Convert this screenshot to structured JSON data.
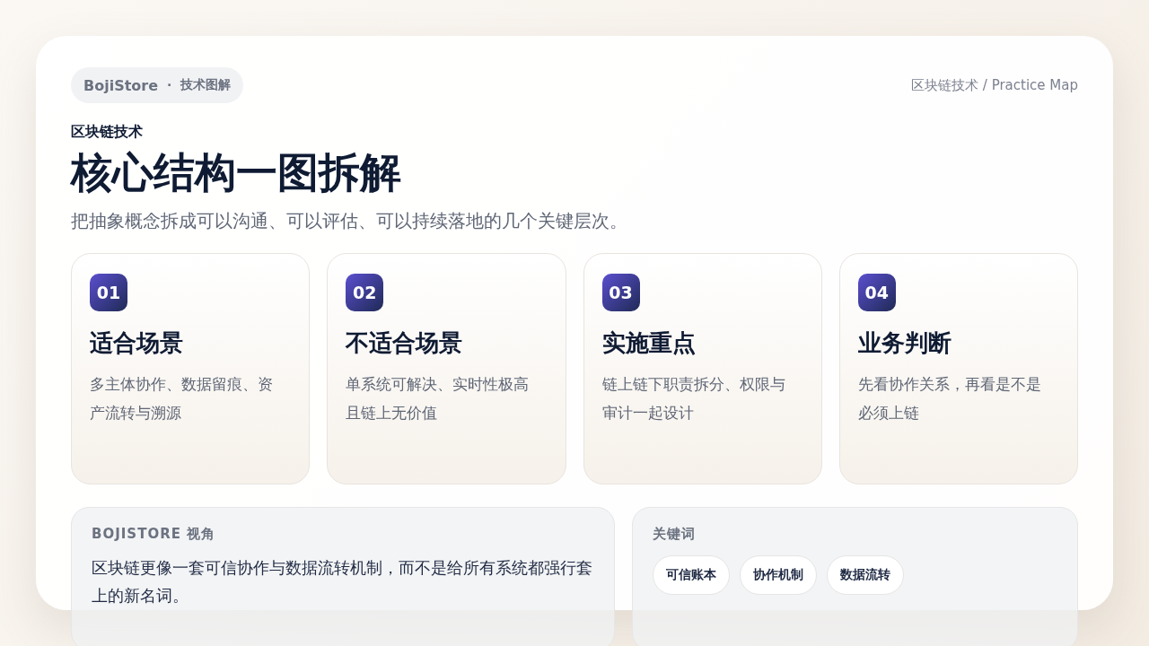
{
  "brand": {
    "name": "BojiStore",
    "separator": "·",
    "section": "技术图解"
  },
  "breadcrumb": "区块链技术 / Practice Map",
  "eyebrow": "区块链技术",
  "title": "核心结构一图拆解",
  "subtitle": "把抽象概念拆成可以沟通、可以评估、可以持续落地的几个关键层次。",
  "cards": [
    {
      "number": "01",
      "title": "适合场景",
      "text": "多主体协作、数据留痕、资产流转与溯源"
    },
    {
      "number": "02",
      "title": "不适合场景",
      "text": "单系统可解决、实时性极高且链上无价值"
    },
    {
      "number": "03",
      "title": "实施重点",
      "text": "链上链下职责拆分、权限与审计一起设计"
    },
    {
      "number": "04",
      "title": "业务判断",
      "text": "先看协作关系，再看是不是必须上链"
    }
  ],
  "perspective": {
    "label": "BOJISTORE 视角",
    "text": "区块链更像一套可信协作与数据流转机制，而不是给所有系统都强行套上的新名词。"
  },
  "keywords": {
    "label": "关键词",
    "tags": [
      "可信账本",
      "协作机制",
      "数据流转"
    ]
  }
}
